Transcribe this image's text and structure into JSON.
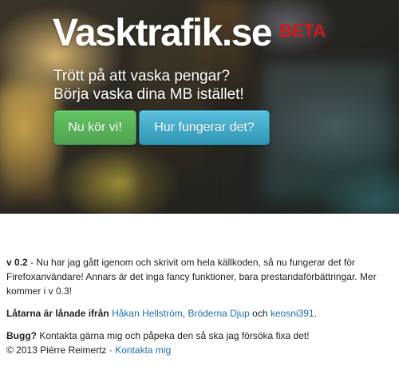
{
  "colors": {
    "logo_text": "#ffffff",
    "beta": "#d21a1a",
    "primary_button": "#5bb75b",
    "info_button": "#49afcd",
    "link": "#1a6fb4",
    "body_text": "#222222"
  },
  "hero": {
    "logo": "Vasktrafik.se",
    "beta": "BETA",
    "tagline_line1": "Trött på att vaska pengar?",
    "tagline_line2": "Börja vaska dina MB istället!",
    "primary_button": "Nu kör vi!",
    "secondary_button": "Hur fungerar det?"
  },
  "content": {
    "version_label": "v 0.2",
    "version_text": " - Nu har jag gått igenom och skrivit om hela källkoden, så nu fungerar det för Firefoxanvändare! Annars är det inga fancy funktioner, bara prestandaförbättringar. Mer kommer i v 0.3!",
    "songs_label": "Låtarna är lånade ifrån",
    "songs_links": [
      "Håkan Hellström",
      "Bröderna Djup",
      "keosni391"
    ],
    "songs_sep1": ", ",
    "songs_sep2": " och ",
    "songs_end": ".",
    "bug_label": "Bugg?",
    "bug_text": " Kontakta gärna mig och påpeka den så ska jag försöka fixa det!",
    "copyright": "© 2013 Piérre Reimertz · ",
    "contact_link": "Kontakta mig"
  }
}
